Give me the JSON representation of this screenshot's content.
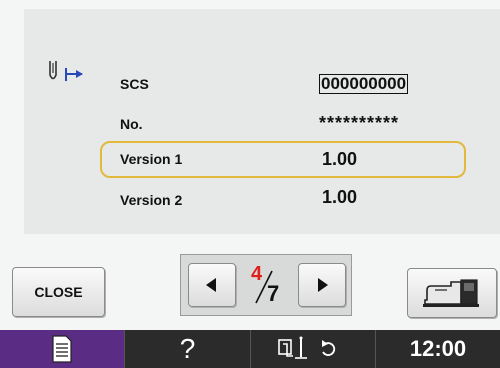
{
  "info": {
    "rows": [
      {
        "label": "SCS",
        "value": "000000000"
      },
      {
        "label": "No.",
        "value": "**********"
      },
      {
        "label": "Version 1",
        "value": "1.00"
      },
      {
        "label": "Version 2",
        "value": "1.00"
      }
    ],
    "highlighted_row": "Version 1"
  },
  "buttons": {
    "close_label": "CLOSE"
  },
  "pager": {
    "current": "4",
    "total": "7",
    "current_color": "#e0201c"
  },
  "statusbar": {
    "time": "12:00",
    "help_glyph": "?",
    "doc_icon": "document-icon",
    "thread_icon": "needle-threader-icon",
    "rotate_icon": "rotate-icon",
    "accent_color": "#5b2c84"
  },
  "icons": {
    "needle": "needle-position-icon",
    "prev": "left-arrow-icon",
    "next": "right-arrow-icon",
    "machine": "embroidery-unit-icon"
  },
  "colors": {
    "highlight_border": "#e3b93d"
  }
}
